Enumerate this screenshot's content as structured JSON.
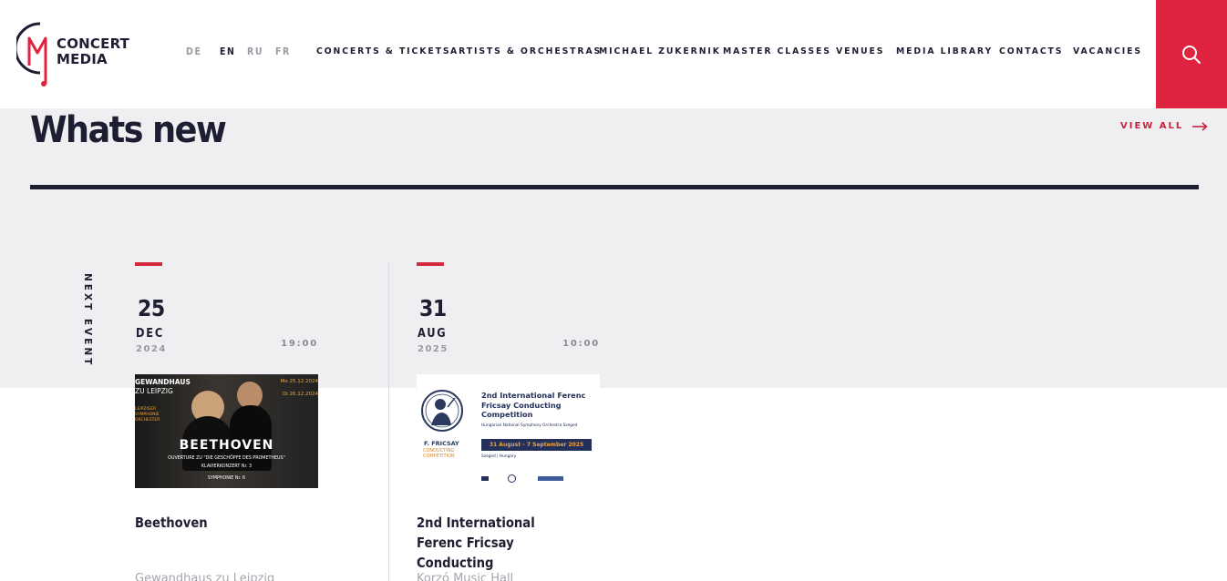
{
  "brand": {
    "line1": "CONCERT",
    "line2": "MEDIA",
    "accent": "#e0243f"
  },
  "languages": [
    {
      "code": "DE",
      "active": false
    },
    {
      "code": "EN",
      "active": true
    },
    {
      "code": "RU",
      "active": false
    },
    {
      "code": "FR",
      "active": false
    }
  ],
  "nav": [
    "CONCERTS & TICKETS",
    "ARTISTS & ORCHESTRAS",
    "MICHAEL ZUKERNIK",
    "MASTER CLASSES",
    "VENUES",
    "MEDIA LIBRARY",
    "CONTACTS",
    "VACANCIES"
  ],
  "search": {
    "icon": "search-icon"
  },
  "section": {
    "title": "Whats new",
    "view_all": "VIEW ALL",
    "next_event_label": "NEXT EVENT"
  },
  "events": [
    {
      "day": "25",
      "month": "DEC",
      "year": "2024",
      "time": "19:00",
      "title": "Beethoven",
      "venue": "Gewandhaus zu Leipzig",
      "poster": {
        "venue_line1": "GEWANDHAUS",
        "venue_line2": "ZU LEIPZIG",
        "dates_line1": "Mo 25.12.2024",
        "dates_line2": "Di 26.12.2024",
        "orchestra": "LEIPZIGER SYMPHONIE ORCHESTER",
        "headline": "BEETHOVEN",
        "sub1": "OUVERTURE ZU \"DIE GESCHÖPFE DES PROMETHEUS\"",
        "sub2": "KLAVIERKONZERT Nr. 3",
        "sub3": "SYMPHONIE Nr. 6"
      }
    },
    {
      "day": "31",
      "month": "AUG",
      "year": "2025",
      "time": "10:00",
      "title": "2nd International Ferenc Fricsay Conducting",
      "venue": "Korzó Music Hall",
      "poster": {
        "headline": "2nd International Ferenc Fricsay Conducting Competition",
        "orchestra": "Hungarian National Symphony Orchestra Szeged",
        "dates": "31 August - 7 September 2025",
        "location": "Szeged | Hungary",
        "logo_line1": "F. FRICSAY",
        "logo_line2": "CONDUCTING",
        "logo_line3": "COMPETITION"
      }
    }
  ]
}
